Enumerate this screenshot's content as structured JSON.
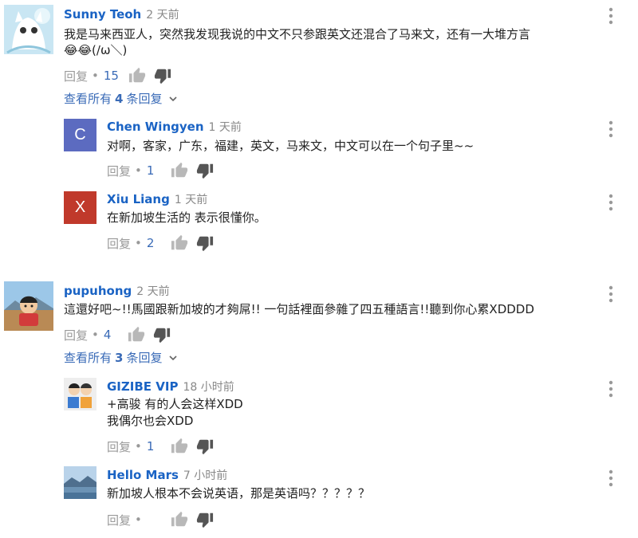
{
  "comments": [
    {
      "author": "Sunny Teoh",
      "time": "2 天前",
      "lines": [
        "我是马来西亚人，突然我发现我说的中文不只参跟英文还混合了马来文，还有一大堆方言",
        "😂😂(/ω＼)"
      ],
      "reply_label": "回复",
      "likes": "15",
      "view_replies": {
        "prefix": "查看所有",
        "count": "4",
        "suffix": "条回复"
      },
      "replies": [
        {
          "author": "Chen Wingyen",
          "time": "1 天前",
          "avatar_letter": "C",
          "avatar_color": "#5c6bc0",
          "lines": [
            "对啊，客家，广东，福建，英文，马来文，中文可以在一个句子里~~"
          ],
          "reply_label": "回复",
          "likes": "1"
        },
        {
          "author": "Xiu Liang",
          "time": "1 天前",
          "avatar_letter": "X",
          "avatar_color": "#c0392b",
          "lines": [
            "在新加坡生活的 表示很懂你。"
          ],
          "reply_label": "回复",
          "likes": "2"
        }
      ]
    },
    {
      "author": "pupuhong",
      "time": "2 天前",
      "lines": [
        "這還好吧~!!馬國跟新加坡的才夠屌!! 一句話裡面參雜了四五種語言!!聽到你心累XDDDD"
      ],
      "reply_label": "回复",
      "likes": "4",
      "view_replies": {
        "prefix": "查看所有",
        "count": "3",
        "suffix": "条回复"
      },
      "replies": [
        {
          "author": "GIZIBE VIP",
          "time": "18 小时前",
          "lines": [
            "+高骏 有的人会这样XDD",
            "我偶尔也会XDD"
          ],
          "reply_label": "回复",
          "likes": "1"
        },
        {
          "author": "Hello Mars",
          "time": "7 小时前",
          "lines": [
            "新加坡人根本不会说英语，那是英语吗？？？？？"
          ],
          "reply_label": "回复",
          "likes": ""
        }
      ]
    }
  ],
  "colors": {
    "author": "#1a63c4",
    "link": "#3a6bb7",
    "meta": "#888888"
  },
  "icons": [
    "thumbs-up-icon",
    "thumbs-down-icon",
    "more-vert-icon",
    "chevron-down-icon"
  ]
}
